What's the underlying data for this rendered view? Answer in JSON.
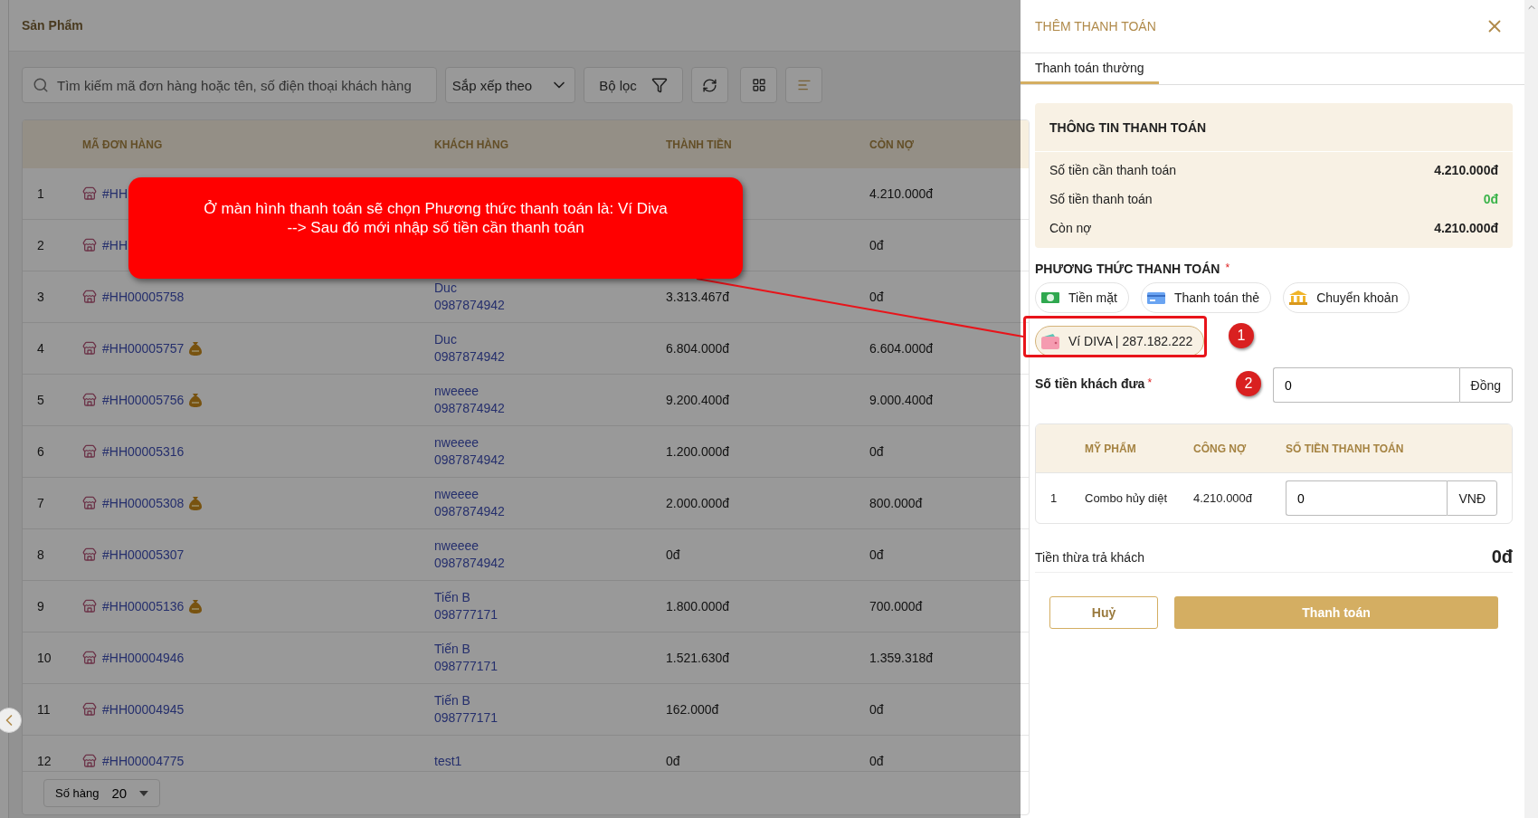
{
  "header": {
    "title": "Sản Phẩm"
  },
  "toolbar": {
    "search": {
      "placeholder": "Tìm kiếm mã đơn hàng hoặc tên, số điện thoại khách hàng"
    },
    "sort": {
      "label": "Sắp xếp theo"
    },
    "filter": {
      "label": "Bộ lọc"
    }
  },
  "table": {
    "columns": [
      "MÃ ĐƠN HÀNG",
      "KHÁCH HÀNG",
      "THÀNH TIỀN",
      "CÒN NỢ"
    ],
    "rows": [
      {
        "index": "1",
        "code": "#HH",
        "has_bag": false,
        "debt": "4.210.000đ"
      },
      {
        "index": "2",
        "code": "#HH",
        "has_bag": false,
        "debt": "0đ"
      },
      {
        "index": "3",
        "code": "#HH00005758",
        "has_bag": false,
        "customer": "Duc",
        "phone": "0987874942",
        "total": "3.313.467đ",
        "debt": "0đ"
      },
      {
        "index": "4",
        "code": "#HH00005757",
        "has_bag": true,
        "customer": "Duc",
        "phone": "0987874942",
        "total": "6.804.000đ",
        "debt": "6.604.000đ"
      },
      {
        "index": "5",
        "code": "#HH00005756",
        "has_bag": true,
        "customer": "nweeee",
        "phone": "0987874942",
        "total": "9.200.400đ",
        "debt": "9.000.400đ"
      },
      {
        "index": "6",
        "code": "#HH00005316",
        "has_bag": false,
        "customer": "nweeee",
        "phone": "0987874942",
        "total": "1.200.000đ",
        "debt": "0đ"
      },
      {
        "index": "7",
        "code": "#HH00005308",
        "has_bag": true,
        "customer": "nweeee",
        "phone": "0987874942",
        "total": "2.000.000đ",
        "debt": "800.000đ"
      },
      {
        "index": "8",
        "code": "#HH00005307",
        "has_bag": false,
        "customer": "nweeee",
        "phone": "0987874942",
        "total": "0đ",
        "debt": "0đ"
      },
      {
        "index": "9",
        "code": "#HH00005136",
        "has_bag": true,
        "customer": "Tiến B",
        "phone": "098777171",
        "total": "1.800.000đ",
        "debt": "700.000đ"
      },
      {
        "index": "10",
        "code": "#HH00004946",
        "has_bag": false,
        "customer": "Tiến B",
        "phone": "098777171",
        "total": "1.521.630đ",
        "debt": "1.359.318đ"
      },
      {
        "index": "11",
        "code": "#HH00004945",
        "has_bag": false,
        "customer": "Tiến B",
        "phone": "098777171",
        "total": "162.000đ",
        "debt": "0đ"
      },
      {
        "index": "12",
        "code": "#HH00004775",
        "has_bag": false,
        "customer": "test1",
        "total": "0đ",
        "debt": "0đ"
      }
    ]
  },
  "pagination": {
    "label": "Số hàng",
    "value": "20"
  },
  "drawer": {
    "title": "THÊM THANH TOÁN",
    "tabs": [
      {
        "label": "Thanh toán thường",
        "selected": true
      }
    ],
    "info": {
      "title": "THÔNG TIN THANH TOÁN",
      "rows": [
        {
          "label": "Số tiền cần thanh toán",
          "value": "4.210.000đ",
          "color": "#222222"
        },
        {
          "label": "Số tiền thanh toán",
          "value": "0đ",
          "color": "#3cb44b"
        },
        {
          "label": "Còn nợ",
          "value": "4.210.000đ",
          "color": "#222222"
        }
      ]
    },
    "methods_label": {
      "text": "PHƯƠNG THỨC THANH TOÁN",
      "required_mark": "*"
    },
    "payment_methods": [
      {
        "kind": "cash",
        "label": "Tiền mặt",
        "selected": false
      },
      {
        "kind": "card",
        "label": "Thanh toán thẻ",
        "selected": false
      },
      {
        "kind": "bank",
        "label": "Chuyển khoản",
        "selected": false
      },
      {
        "kind": "wallet",
        "label": "Ví DIVA | 287.182.222",
        "selected": true
      }
    ],
    "given": {
      "label": "Số tiền khách đưa",
      "required_mark": "*",
      "value": "0",
      "unit": "Đồng"
    },
    "items": {
      "columns": [
        "MỸ PHẨM",
        "CÔNG NỢ",
        "SỐ TIỀN THANH TOÁN"
      ],
      "rows": [
        {
          "index": "1",
          "name": "Combo hủy diệt",
          "debt": "4.210.000đ",
          "value": "0",
          "unit": "VNĐ"
        }
      ]
    },
    "change": {
      "label": "Tiền thừa trả khách",
      "value": "0đ"
    },
    "buttons": {
      "cancel": "Huỷ",
      "submit": "Thanh toán"
    }
  },
  "annotation": {
    "lines": [
      "Ở màn hình thanh toán sẽ chọn Phương thức thanh toán là: Ví Diva",
      "--> Sau đó mới nhập số tiền cần thanh toán"
    ],
    "markers": [
      "1",
      "2"
    ]
  }
}
